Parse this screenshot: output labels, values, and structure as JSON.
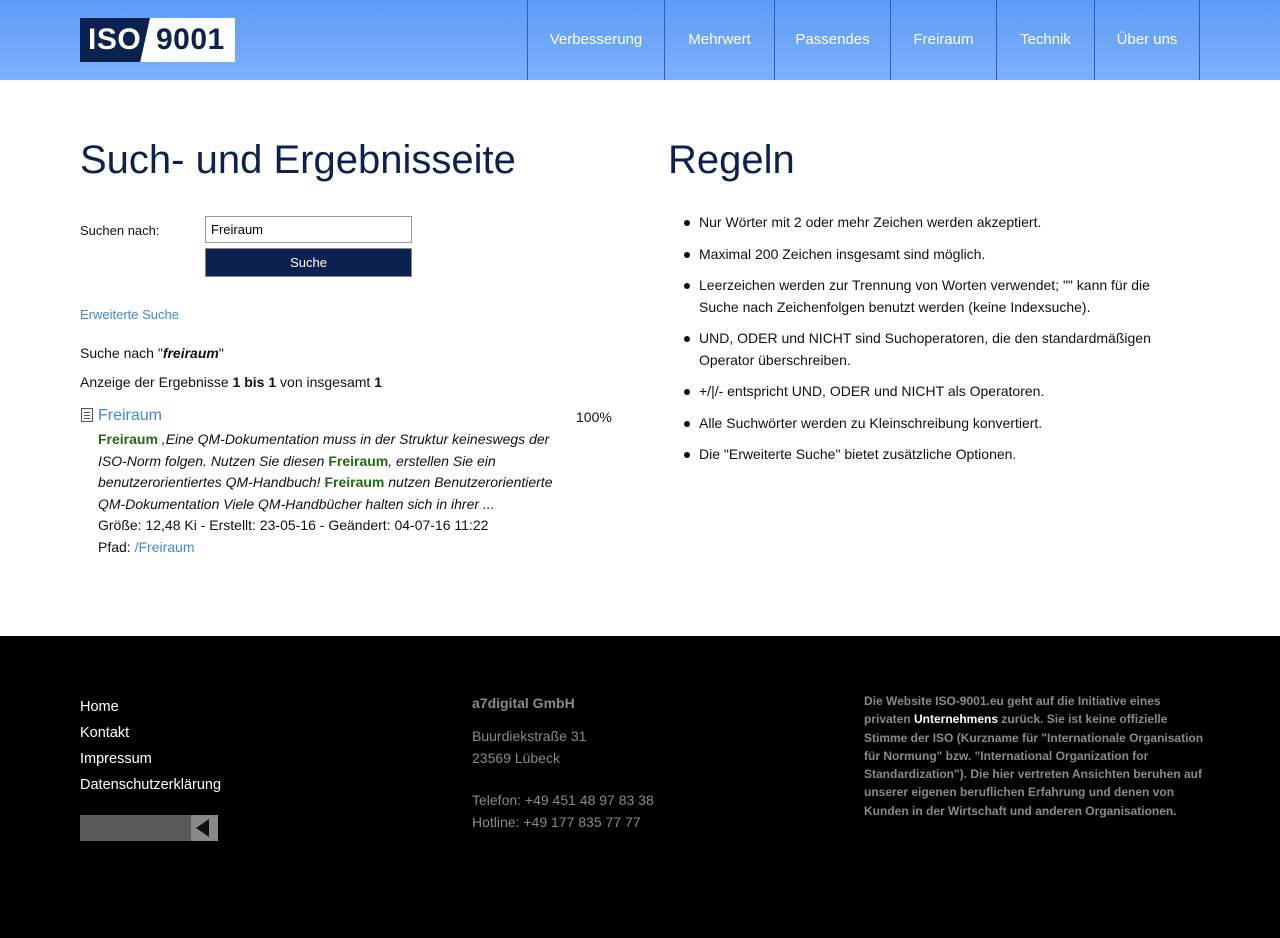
{
  "header": {
    "logo_left": "ISO",
    "logo_right": "9001",
    "nav": [
      "Verbesserung",
      "Mehrwert",
      "Passendes",
      "Freiraum",
      "Technik",
      "Über uns"
    ]
  },
  "search": {
    "heading": "Such- und Ergebnisseite",
    "label": "Suchen nach:",
    "value": "Freiraum",
    "button": "Suche",
    "advanced_link": "Erweiterte Suche",
    "query_prefix": "Suche nach \"",
    "query_term": "freiraum",
    "query_suffix": "\"",
    "results_prefix": "Anzeige der Ergebnisse ",
    "results_range": "1 bis 1",
    "results_mid": " von insgesamt ",
    "results_total": "1"
  },
  "result": {
    "title": "Freiraum",
    "score": "100%",
    "hl1": "Freiraum",
    "s1": " ,Eine QM-Dokumentation muss in der Struktur keineswegs der ISO-Norm folgen. Nutzen Sie diesen ",
    "hl2": "Freiraum",
    "s2": ", erstellen Sie ein benutzerorientiertes QM-Handbuch! ",
    "hl3": "Freiraum",
    "s3": " nutzen Benutzerorientierte QM-Dokumentation Viele QM-Handbücher halten sich in ihrer ...",
    "meta": "Größe: 12,48 Ki - Erstellt: 23-05-16 - Geändert: 04-07-16 11:22",
    "path_label": "Pfad: ",
    "path_link": "/Freiraum"
  },
  "rules": {
    "heading": "Regeln",
    "items": [
      "Nur Wörter mit 2 oder mehr Zeichen werden akzeptiert.",
      "Maximal 200 Zeichen insgesamt sind möglich.",
      "Leerzeichen werden zur Trennung von Worten verwendet; \"\" kann für die Suche nach Zeichenfolgen benutzt werden (keine Indexsuche).",
      "UND, ODER und NICHT sind Suchoperatoren, die den standardmäßigen Operator überschreiben.",
      "+/|/- entspricht UND, ODER und NICHT als Operatoren.",
      "Alle Suchwörter werden zu Kleinschreibung konvertiert.",
      "Die \"Erweiterte Suche\" bietet zusätzliche Optionen."
    ]
  },
  "footer": {
    "links": [
      "Home",
      "Kontakt",
      "Impressum",
      "Datenschutzerklärung"
    ],
    "company": {
      "name": "a7digital GmbH",
      "street": "Buurdiekstraße 31",
      "city": "23569 Lübeck",
      "phone": "Telefon: +49 451 48 97 83 38",
      "hotline": "Hotline: +49 177 835 77 77"
    },
    "about_1": "Die Website ISO-9001.eu geht auf die Initiative eines privaten ",
    "about_highlight": "Unternehmens",
    "about_2": " zurück. Sie ist keine offizielle Stimme der ISO (Kurzname für \"Internationale Organisation für Normung\" bzw. \"International Organization for Standardization\"). Die hier vertreten Ansichten beruhen auf unserer eigenen beruflichen Erfahrung und denen von Kunden in der Wirtschaft und anderen Organisationen."
  }
}
